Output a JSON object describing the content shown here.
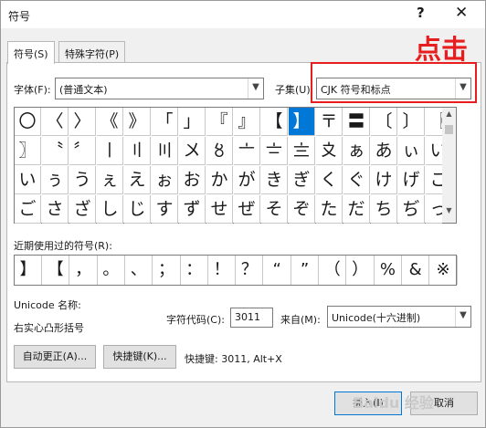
{
  "window": {
    "title": "符号",
    "help_icon": "?",
    "close_icon": "✕"
  },
  "tabs": [
    {
      "label": "符号(S)",
      "active": true
    },
    {
      "label": "特殊字符(P)",
      "active": false
    }
  ],
  "font": {
    "label": "字体(F):",
    "value": "(普通文本)"
  },
  "subset": {
    "label": "子集(U):",
    "value": "CJK 符号和标点"
  },
  "annotation": "点击",
  "symbol_grid": {
    "rows": [
      [
        "〇",
        "〈",
        "〉",
        "《",
        "》",
        "「",
        "」",
        "『",
        "』",
        "【",
        "】",
        "〒",
        "〓",
        "〔",
        "〕",
        "〖"
      ],
      [
        "〗",
        "〝",
        "〞",
        "〡",
        "〢",
        "〣",
        "〤",
        "〥",
        "〦",
        "〧",
        "〨",
        "〩",
        "ぁ",
        "あ",
        "ぃ",
        "い"
      ],
      [
        "い",
        "ぅ",
        "う",
        "ぇ",
        "え",
        "ぉ",
        "お",
        "か",
        "が",
        "き",
        "ぎ",
        "く",
        "ぐ",
        "け",
        "げ",
        "こ"
      ],
      [
        "ご",
        "さ",
        "ざ",
        "し",
        "じ",
        "す",
        "ず",
        "せ",
        "ぜ",
        "そ",
        "ぞ",
        "た",
        "だ",
        "ち",
        "ぢ",
        "っ"
      ]
    ],
    "selected": "】"
  },
  "recent": {
    "label": "近期使用过的符号(R):",
    "symbols": [
      "】",
      "【",
      "，",
      "。",
      "、",
      "；",
      "：",
      "！",
      "？",
      "“",
      "”",
      "（",
      "）",
      "%",
      "&",
      "※"
    ]
  },
  "unicode": {
    "name_label": "Unicode 名称:",
    "name_value": "右实心凸形括号",
    "code_label": "字符代码(C):",
    "code_value": "3011",
    "from_label": "来自(M):",
    "from_value": "Unicode(十六进制)"
  },
  "buttons": {
    "autocorrect": "自动更正(A)...",
    "shortcut_key": "快捷键(K)...",
    "shortcut_text": "快捷键: 3011, Alt+X",
    "insert": "插入(I)",
    "cancel": "取消"
  },
  "watermark": "Baidu 经验",
  "colors": {
    "accent": "#0078d7",
    "annotation_red": "#e81e1e"
  }
}
